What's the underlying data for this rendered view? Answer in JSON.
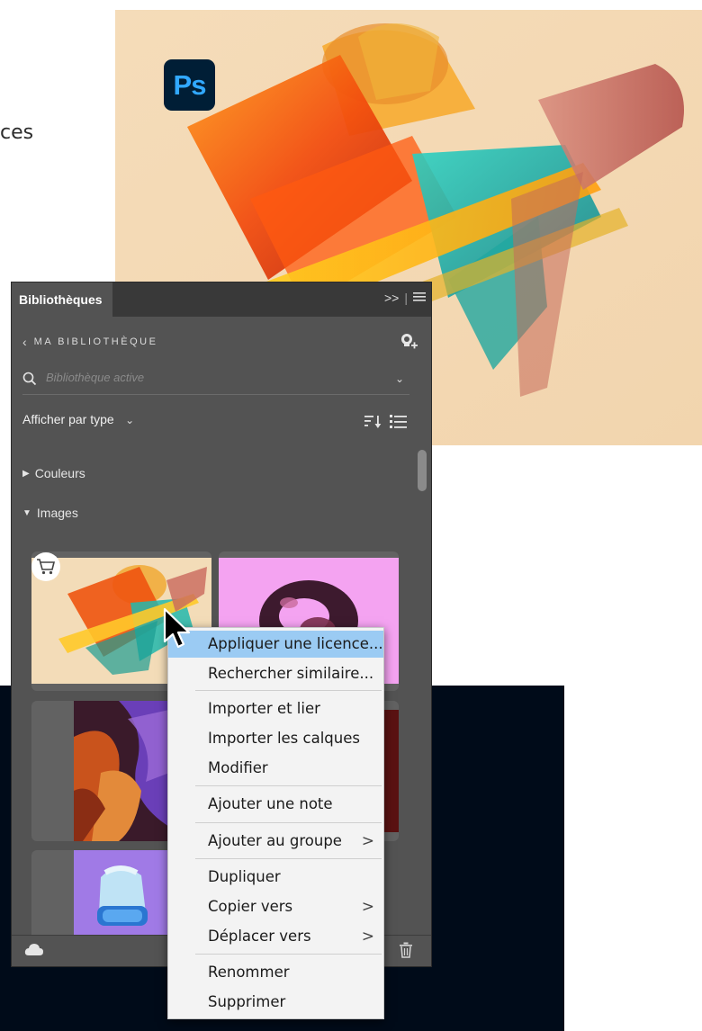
{
  "background": {
    "partial_text": "ces",
    "app_badge": "Ps"
  },
  "panel": {
    "tab_title": "Bibliothèques",
    "expand_label": ">>",
    "library_title": "MA BIBLIOTHÈQUE",
    "search": {
      "placeholder": "Bibliothèque active"
    },
    "view_label": "Afficher par type",
    "sections": [
      {
        "label": "Couleurs",
        "expanded": false
      },
      {
        "label": "Images",
        "expanded": true
      }
    ],
    "thumbnails": [
      {
        "name": "abstract-glass-sculpture",
        "licensed": false
      },
      {
        "name": "pink-3d-knot"
      },
      {
        "name": "antelope-canyon"
      },
      {
        "name": "dark-red-image"
      },
      {
        "name": "vr-headset-figure"
      }
    ]
  },
  "context_menu": {
    "items": [
      {
        "label": "Appliquer une licence...",
        "highlighted": true,
        "submenu": false
      },
      {
        "label": "Rechercher similaire...",
        "submenu": false
      },
      {
        "label": "Importer et lier",
        "submenu": false
      },
      {
        "label": "Importer les calques",
        "submenu": false
      },
      {
        "label": "Modifier",
        "submenu": false
      },
      {
        "label": "Ajouter une note",
        "submenu": false
      },
      {
        "label": "Ajouter au groupe",
        "submenu": true
      },
      {
        "label": "Dupliquer",
        "submenu": false
      },
      {
        "label": "Copier vers",
        "submenu": true
      },
      {
        "label": "Déplacer vers",
        "submenu": true
      },
      {
        "label": "Renommer",
        "submenu": false
      },
      {
        "label": "Supprimer",
        "submenu": false
      }
    ],
    "submenu_arrow": ">"
  },
  "colors": {
    "panel_bg": "#535353",
    "tab_bar_bg": "#393939",
    "menu_bg": "#f3f3f3",
    "menu_highlight": "#9bcbf3",
    "ps_badge_bg": "#001e36",
    "ps_badge_text": "#31a8ff",
    "dark_band": "#000b19"
  }
}
